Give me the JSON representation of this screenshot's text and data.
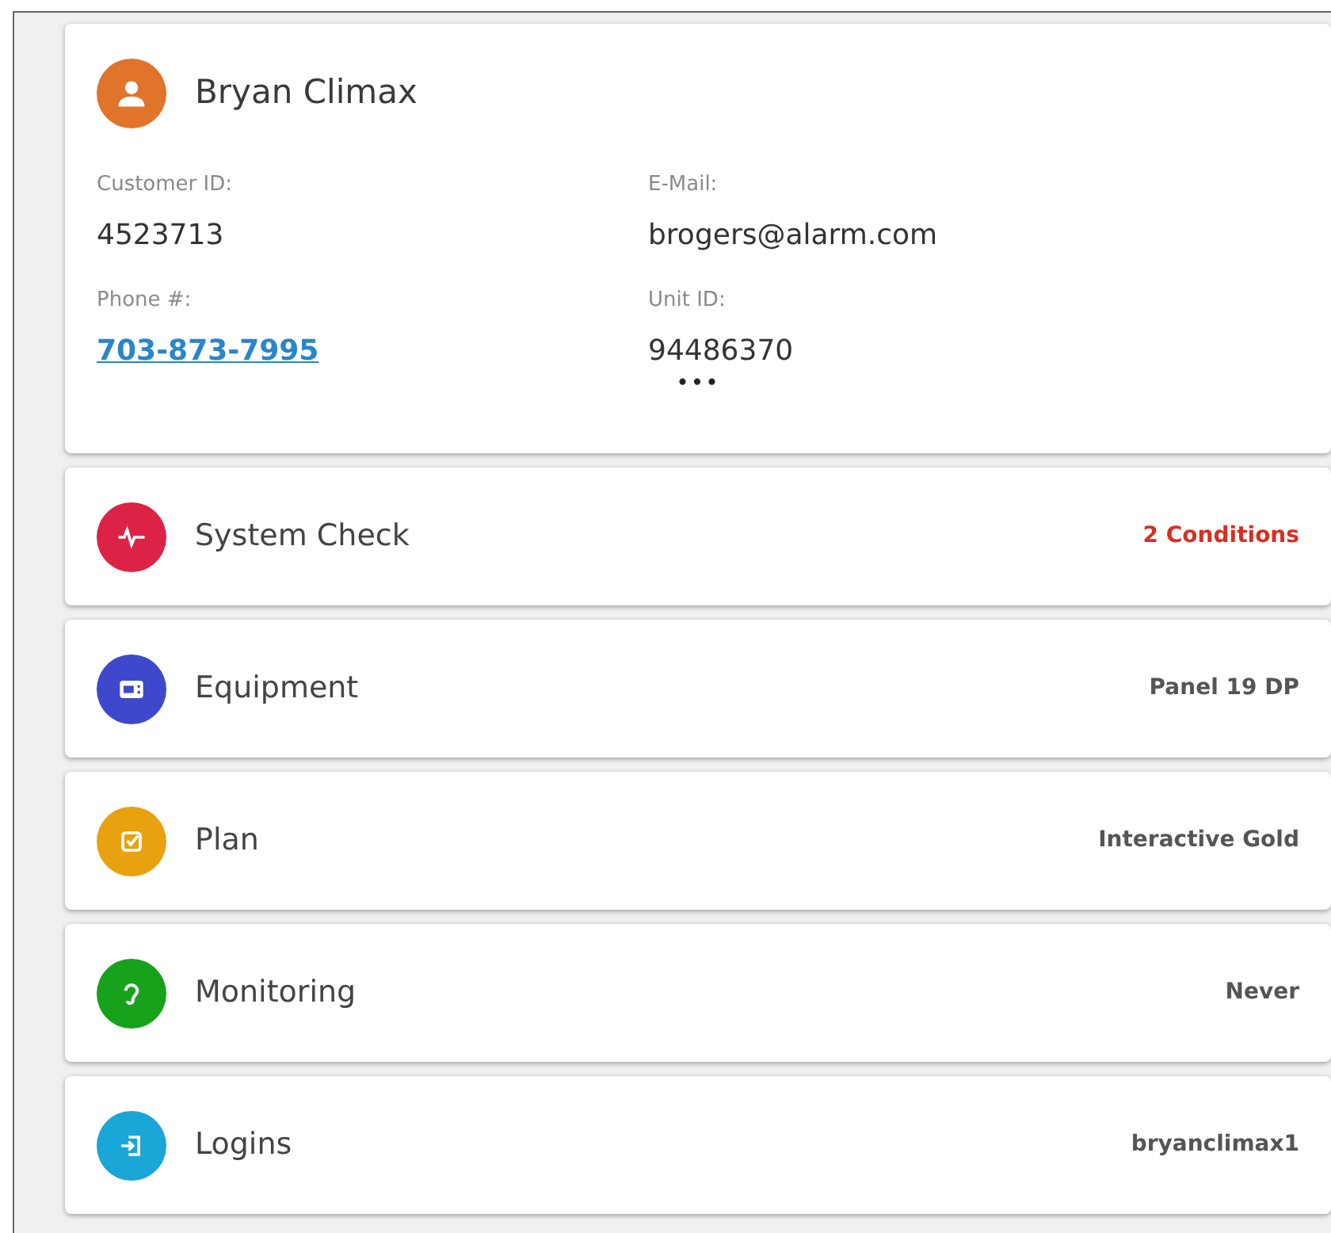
{
  "customer": {
    "name": "Bryan Climax",
    "fields": [
      {
        "label": "Customer ID:",
        "value": "4523713",
        "kind": "text"
      },
      {
        "label": "E-Mail:",
        "value": "brogers@alarm.com",
        "kind": "text"
      },
      {
        "label": "Phone #:",
        "value": "703-873-7995",
        "kind": "link"
      },
      {
        "label": "Unit ID:",
        "value": "94486370",
        "kind": "text"
      }
    ],
    "more": "•••"
  },
  "sections": [
    {
      "title": "System Check",
      "value": "2 Conditions",
      "kind": "pulse",
      "color": "#dc2346",
      "alert": true
    },
    {
      "title": "Equipment",
      "value": "Panel 19 DP",
      "kind": "panel",
      "color": "#3f48cc",
      "alert": false
    },
    {
      "title": "Plan",
      "value": "Interactive Gold",
      "kind": "check",
      "color": "#e8a210",
      "alert": false
    },
    {
      "title": "Monitoring",
      "value": "Never",
      "kind": "ear",
      "color": "#16a21a",
      "alert": false
    },
    {
      "title": "Logins",
      "value": "bryanclimax1",
      "kind": "login",
      "color": "#1aa6d6",
      "alert": false
    }
  ]
}
